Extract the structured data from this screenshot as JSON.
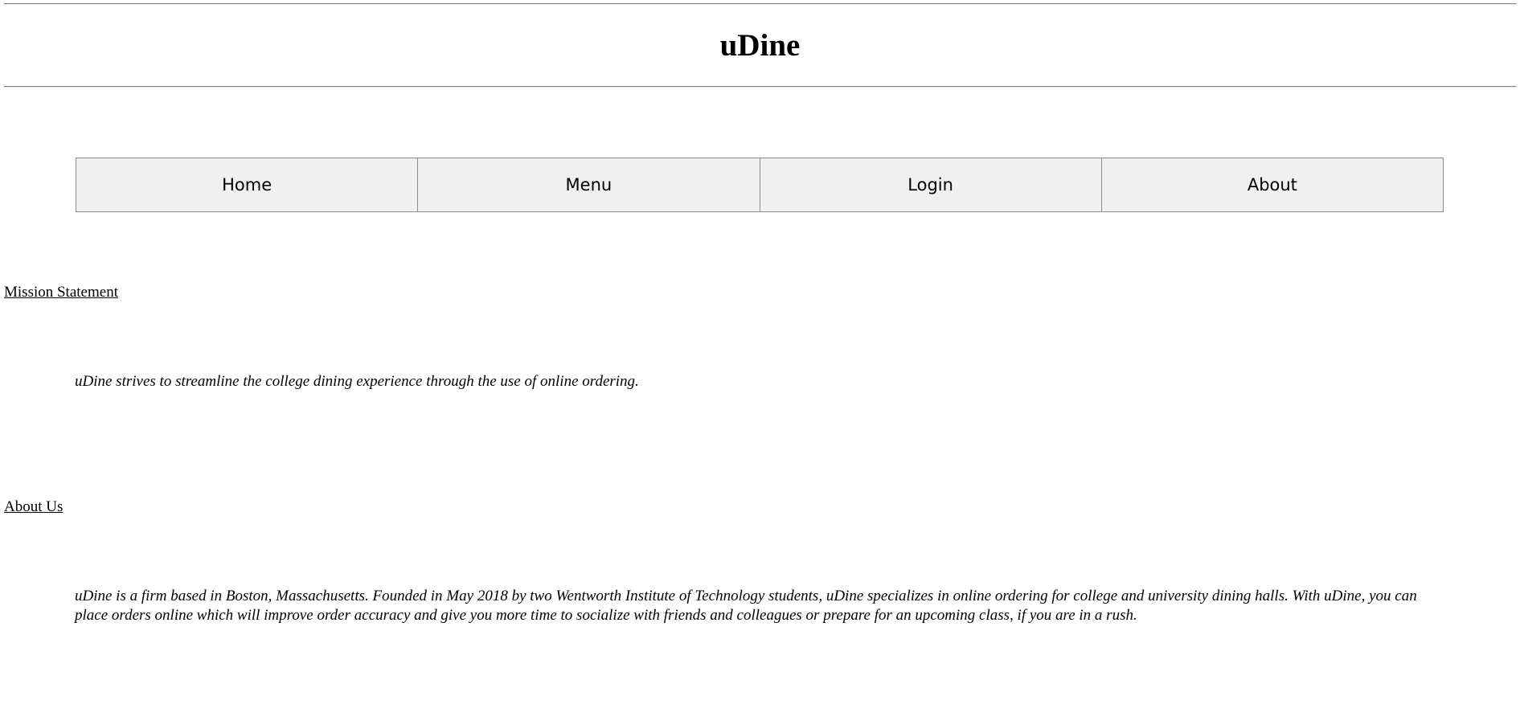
{
  "header": {
    "title": "uDine"
  },
  "nav": {
    "items": [
      {
        "label": "Home"
      },
      {
        "label": "Menu"
      },
      {
        "label": "Login"
      },
      {
        "label": "About"
      }
    ]
  },
  "sections": {
    "mission": {
      "heading": "Mission Statement",
      "body": "uDine strives to streamline the college dining experience through the use of online ordering."
    },
    "about": {
      "heading": "About Us",
      "body": "uDine is a firm based in Boston, Massachusetts. Founded in May 2018 by two Wentworth Institute of Technology students, uDine specializes in online ordering for college and university dining halls. With uDine, you can place orders online which will improve order accuracy and give you more time to socialize with friends and colleagues or prepare for an upcoming class, if you are in a rush."
    }
  },
  "colors": {
    "rule": "#808080",
    "button_background": "#f0f0f0",
    "button_border": "#8c8c8c",
    "text": "#000000"
  }
}
